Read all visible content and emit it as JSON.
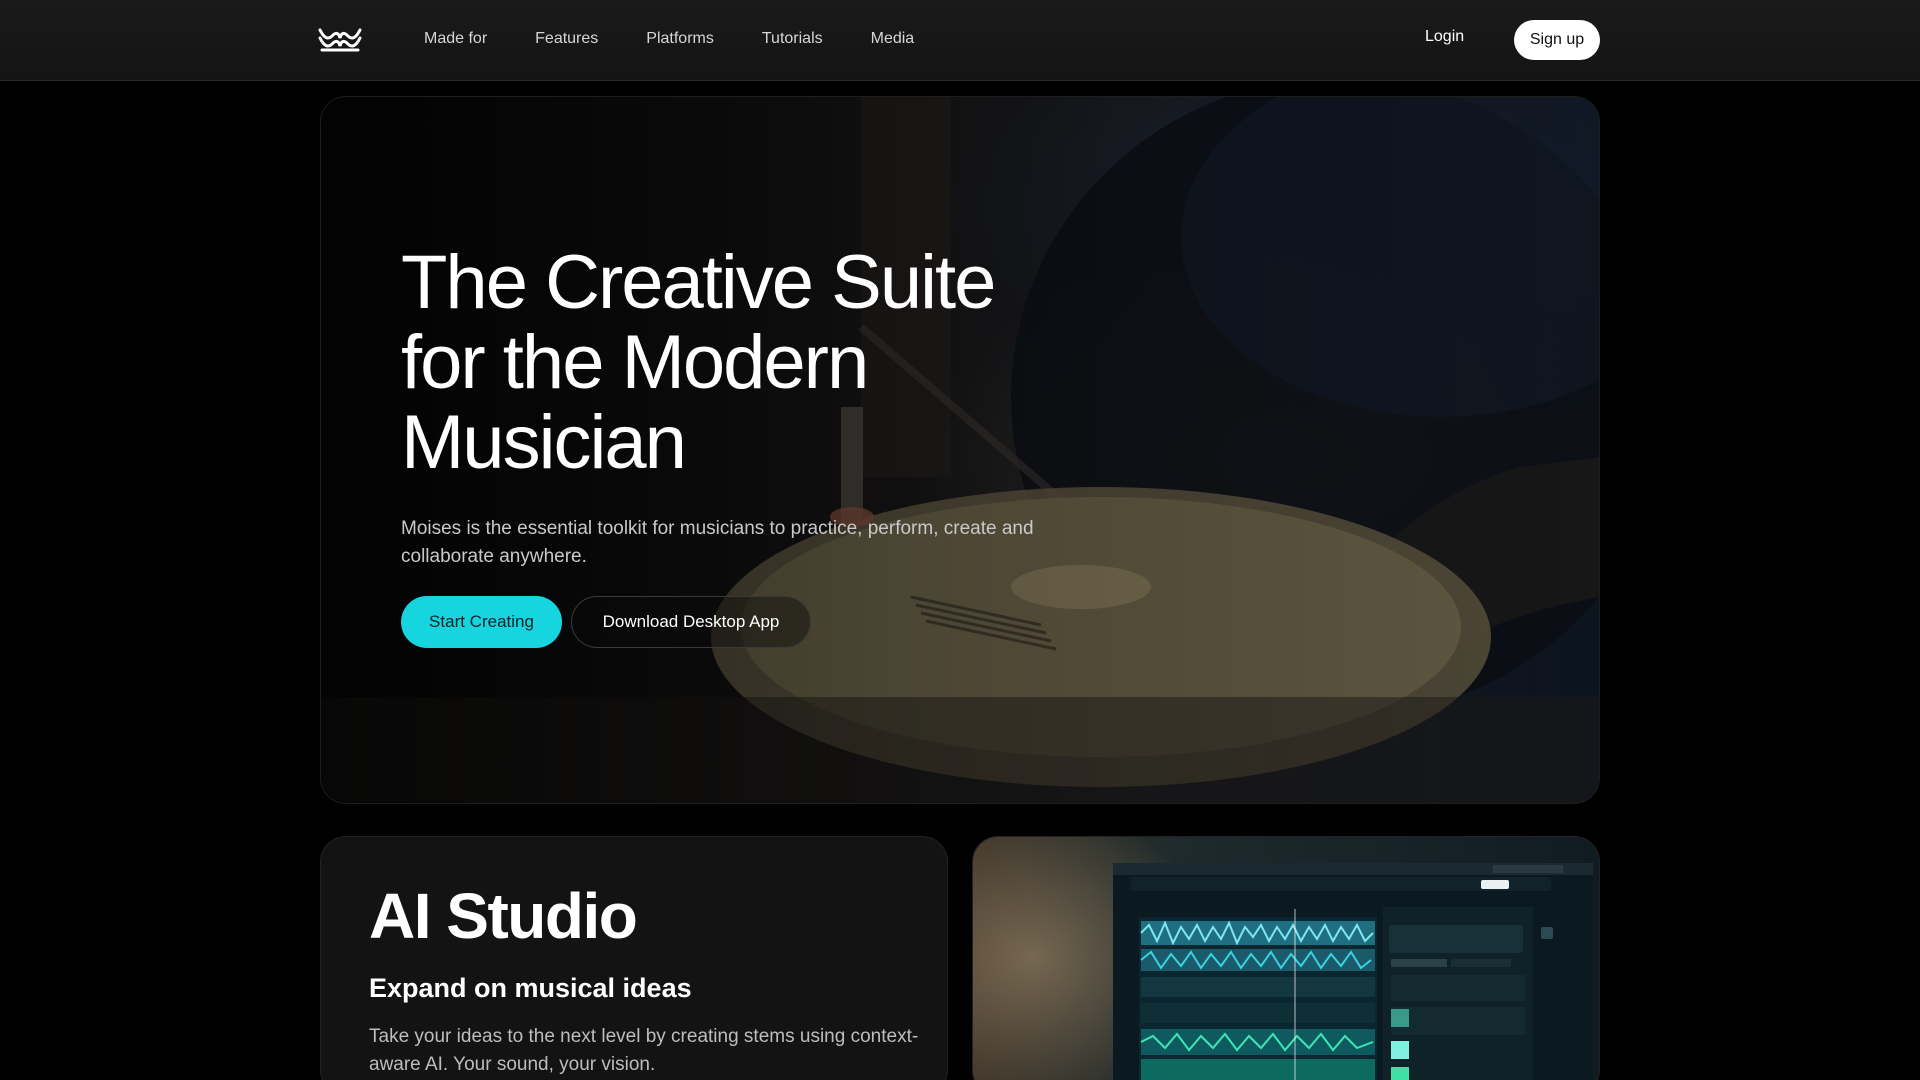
{
  "nav": {
    "logo_icon": "moises-wave-logo-icon",
    "links": [
      "Made for",
      "Features",
      "Platforms",
      "Tutorials",
      "Media"
    ],
    "login_label": "Login",
    "signup_label": "Sign up"
  },
  "hero": {
    "title_lines": [
      "The Creative Suite",
      "for the Modern",
      "Musician"
    ],
    "subtitle": "Moises is the essential toolkit for musicians to practice, perform, create and collaborate anywhere.",
    "primary_button": "Start Creating",
    "secondary_button": "Download Desktop App",
    "accent_color": "#16d5de"
  },
  "ai_studio": {
    "title": "AI Studio",
    "subtitle": "Expand on musical ideas",
    "description": "Take your ideas to the next level by creating stems using context-aware AI. Your sound, your vision."
  }
}
